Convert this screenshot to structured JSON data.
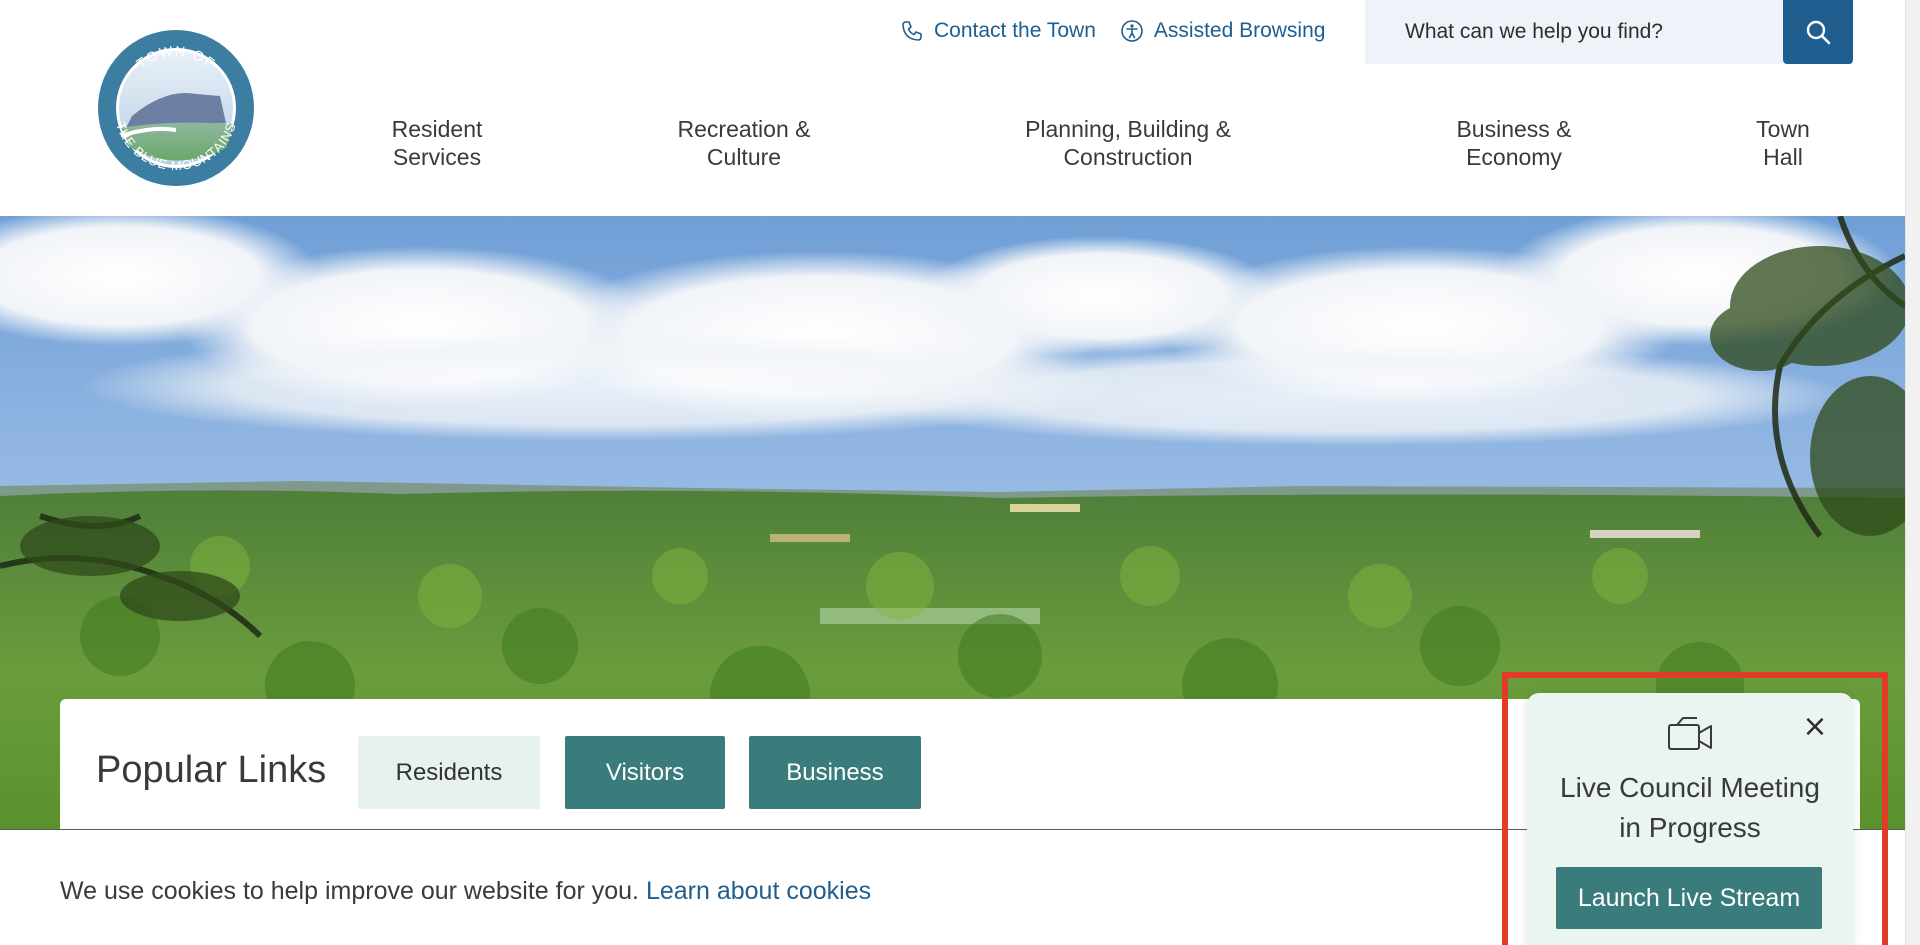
{
  "header": {
    "logo": {
      "top_text": "TOWN OF",
      "bottom_text": "THE BLUE MOUNTAINS",
      "colors": {
        "ring": "#3b7ea1",
        "sky": "#cfe1f1",
        "land": "#7fb07a"
      }
    },
    "utility": {
      "contact_label": "Contact the Town",
      "contact_icon": "phone-icon",
      "assisted_label": "Assisted Browsing",
      "assisted_icon": "accessibility-icon"
    },
    "search": {
      "placeholder": "What can we help you find?",
      "button_icon": "search-icon"
    },
    "nav": [
      {
        "line1": "Resident",
        "line2": "Services"
      },
      {
        "line1": "Recreation &",
        "line2": "Culture"
      },
      {
        "line1": "Planning, Building &",
        "line2": "Construction"
      },
      {
        "line1": "Business &",
        "line2": "Economy"
      },
      {
        "line1": "Town",
        "line2": "Hall"
      }
    ]
  },
  "popular_links": {
    "title": "Popular Links",
    "buttons": {
      "residents": "Residents",
      "visitors": "Visitors",
      "business": "Business"
    }
  },
  "cookie_bar": {
    "text": "We use cookies to help improve our website for you.",
    "link": "Learn about cookies"
  },
  "live_popup": {
    "icon": "video-camera-icon",
    "close_icon": "close-icon",
    "title": "Live Council Meeting in Progress",
    "button": "Launch Live Stream"
  },
  "colors": {
    "brand_blue": "#1f5e8e",
    "teal": "#3a7b7b",
    "light_teal": "#e6f1f0",
    "popup_bg": "#e9f5ee",
    "highlight_red": "#e23b27",
    "search_bg": "#eef3fa"
  }
}
